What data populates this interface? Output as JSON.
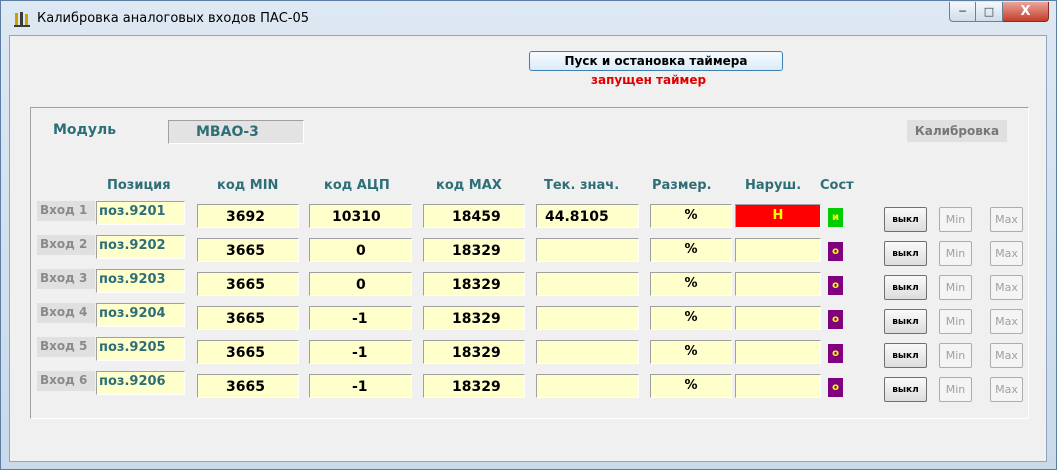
{
  "window": {
    "title": "Калибровка аналоговых входов ПАС-05",
    "controls": {
      "minimize": "─",
      "maximize": "□",
      "close": "X"
    }
  },
  "timer": {
    "button_label": "Пуск и остановка таймера",
    "status": "запущен таймер"
  },
  "module": {
    "label": "Модуль",
    "value": "МВАО-3"
  },
  "calibration_label": "Калибровка",
  "headers": {
    "position": "Позиция",
    "code_min": "код MIN",
    "code_adc": "код  АЦП",
    "code_max": "код MAX",
    "current": "Тек. знач.",
    "unit": "Размер.",
    "violation": "Наруш.",
    "state": "Сост"
  },
  "rows": [
    {
      "label": "Вход 1",
      "position": "поз.9201",
      "code_min": "3692",
      "code_adc": "10310",
      "code_max": "18459",
      "current": "44.8105",
      "unit": "%",
      "violation": "Н",
      "state": "и",
      "off": "выкл",
      "min": "Min",
      "max": "Max"
    },
    {
      "label": "Вход 2",
      "position": "поз.9202",
      "code_min": "3665",
      "code_adc": "0",
      "code_max": "18329",
      "current": "",
      "unit": "%",
      "violation": "",
      "state": "о",
      "off": "выкл",
      "min": "Min",
      "max": "Max"
    },
    {
      "label": "Вход 3",
      "position": "поз.9203",
      "code_min": "3665",
      "code_adc": "0",
      "code_max": "18329",
      "current": "",
      "unit": "%",
      "violation": "",
      "state": "о",
      "off": "выкл",
      "min": "Min",
      "max": "Max"
    },
    {
      "label": "Вход 4",
      "position": "поз.9204",
      "code_min": "3665",
      "code_adc": "-1",
      "code_max": "18329",
      "current": "",
      "unit": "%",
      "violation": "",
      "state": "о",
      "off": "выкл",
      "min": "Min",
      "max": "Max"
    },
    {
      "label": "Вход 5",
      "position": "поз.9205",
      "code_min": "3665",
      "code_adc": "-1",
      "code_max": "18329",
      "current": "",
      "unit": "%",
      "violation": "",
      "state": "о",
      "off": "выкл",
      "min": "Min",
      "max": "Max"
    },
    {
      "label": "Вход 6",
      "position": "поз.9206",
      "code_min": "3665",
      "code_adc": "-1",
      "code_max": "18329",
      "current": "",
      "unit": "%",
      "violation": "",
      "state": "о",
      "off": "выкл",
      "min": "Min",
      "max": "Max"
    }
  ],
  "colors": {
    "teal_label": "#2e6f77",
    "field_bg": "#ffffcc",
    "violation_active": "#ff0000",
    "state_active": "#00cc00",
    "state_inactive": "#800080",
    "timer_status": "#e00000"
  }
}
